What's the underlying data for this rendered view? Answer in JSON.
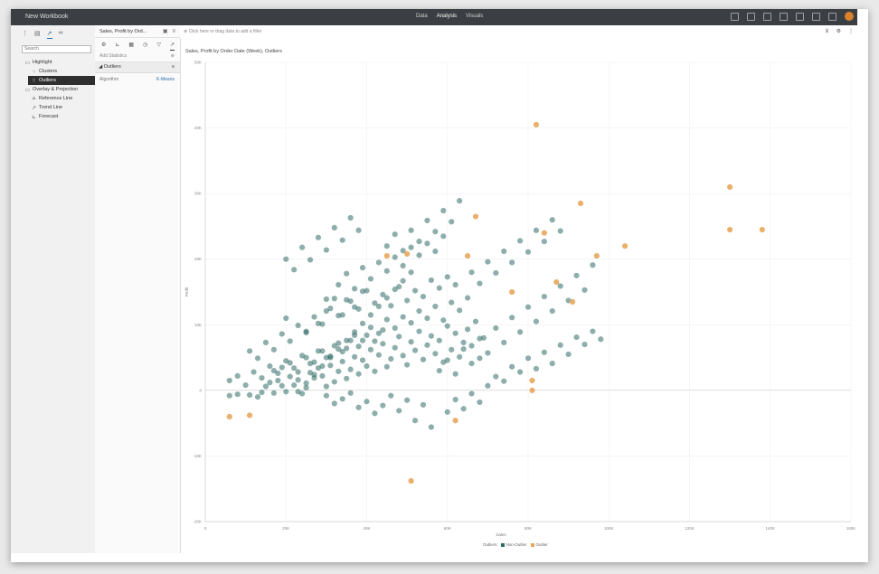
{
  "app": {
    "title": "New Workbook",
    "menu": [
      "Data",
      "Analysis",
      "Visuals"
    ],
    "menu_active": 1
  },
  "left_panel": {
    "tabs": [
      {
        "icon": "layers-icon",
        "glyph": "⋮"
      },
      {
        "icon": "chart-icon",
        "glyph": "▤"
      },
      {
        "icon": "analytics-icon",
        "glyph": "↗"
      },
      {
        "icon": "glasses-icon",
        "glyph": "∞"
      }
    ],
    "search_placeholder": "Search",
    "tree": [
      {
        "label": "Highlight",
        "level": 1,
        "icon": "folder-icon",
        "glyph": "▭"
      },
      {
        "label": "Clusters",
        "level": 2,
        "icon": "clusters-icon",
        "glyph": "⁘"
      },
      {
        "label": "Outliers",
        "level": 2,
        "icon": "outliers-icon",
        "glyph": "⁙",
        "selected": true
      },
      {
        "label": "Overlay & Projection",
        "level": 1,
        "icon": "folder-icon",
        "glyph": "▭"
      },
      {
        "label": "Reference Line",
        "level": 2,
        "icon": "reference-line-icon",
        "glyph": "≟"
      },
      {
        "label": "Trend Line",
        "level": 2,
        "icon": "trend-line-icon",
        "glyph": "↗"
      },
      {
        "label": "Forecast",
        "level": 2,
        "icon": "forecast-icon",
        "glyph": "⊾"
      }
    ]
  },
  "middle_panel": {
    "viz_name": "Sales, Profit by Ord...",
    "icons": [
      "⚙",
      "⊾",
      "▦",
      "◷",
      "▽",
      "↗"
    ],
    "add_statistics": "Add Statistics",
    "section": "Outliers",
    "algorithm_label": "Algorithm",
    "algorithm_value": "K-Means"
  },
  "filter_bar": {
    "placeholder": "Click here or drag data to add a filter"
  },
  "viz": {
    "title": "Sales, Profit by Order Date (Week), Outliers",
    "legend_title": "Outliers",
    "colors": {
      "non_outlier": "#2f6b66",
      "outlier": "#e8a65b",
      "grey": "#b9b9b9"
    }
  },
  "chart_data": {
    "type": "scatter",
    "title": "Sales, Profit by Order Date (Week), Outliers",
    "xlabel": "Sales",
    "ylabel": "Profit",
    "xlim": [
      0,
      160000
    ],
    "ylim": [
      -20000,
      50000
    ],
    "x_ticks": [
      "0",
      "20K",
      "40K",
      "60K",
      "80K",
      "100K",
      "120K",
      "140K",
      "160K"
    ],
    "y_ticks": [
      "-20K",
      "-10K",
      "0",
      "10K",
      "20K",
      "30K",
      "40K",
      "50K"
    ],
    "grid": true,
    "legend_position": "bottom",
    "series": [
      {
        "name": "Non-Outlier",
        "points": [
          [
            6000,
            -800
          ],
          [
            8000,
            -600
          ],
          [
            11000,
            -700
          ],
          [
            13000,
            -1000
          ],
          [
            14000,
            -300
          ],
          [
            15000,
            600
          ],
          [
            16000,
            1200
          ],
          [
            17000,
            -400
          ],
          [
            18000,
            1500
          ],
          [
            19000,
            700
          ],
          [
            20000,
            -200
          ],
          [
            21000,
            2100
          ],
          [
            22000,
            800
          ],
          [
            23000,
            1600
          ],
          [
            24000,
            -500
          ],
          [
            25000,
            400
          ],
          [
            26000,
            2700
          ],
          [
            27000,
            1900
          ],
          [
            28000,
            3400
          ],
          [
            29000,
            2200
          ],
          [
            30000,
            600
          ],
          [
            31000,
            3800
          ],
          [
            32000,
            1300
          ],
          [
            33000,
            2900
          ],
          [
            34000,
            4400
          ],
          [
            35000,
            1800
          ],
          [
            36000,
            3200
          ],
          [
            37000,
            5100
          ],
          [
            38000,
            2500
          ],
          [
            39000,
            4600
          ],
          [
            40000,
            3700
          ],
          [
            41000,
            6200
          ],
          [
            42000,
            2900
          ],
          [
            43000,
            5400
          ],
          [
            44000,
            7100
          ],
          [
            45000,
            3600
          ],
          [
            46000,
            4800
          ],
          [
            47000,
            6500
          ],
          [
            48000,
            8200
          ],
          [
            49000,
            5300
          ],
          [
            50000,
            3900
          ],
          [
            51000,
            7400
          ],
          [
            52000,
            6100
          ],
          [
            53000,
            9000
          ],
          [
            54000,
            4700
          ],
          [
            55000,
            6900
          ],
          [
            56000,
            8300
          ],
          [
            57000,
            5600
          ],
          [
            58000,
            7600
          ],
          [
            59000,
            4300
          ],
          [
            60000,
            9800
          ],
          [
            61000,
            6200
          ],
          [
            62000,
            8700
          ],
          [
            63000,
            5100
          ],
          [
            64000,
            7300
          ],
          [
            65000,
            9300
          ],
          [
            66000,
            6800
          ],
          [
            67000,
            10500
          ],
          [
            68000,
            4900
          ],
          [
            69000,
            8000
          ],
          [
            17000,
            3000
          ],
          [
            19000,
            3500
          ],
          [
            21000,
            4200
          ],
          [
            23000,
            2800
          ],
          [
            25000,
            5000
          ],
          [
            27000,
            4300
          ],
          [
            29000,
            6000
          ],
          [
            31000,
            5200
          ],
          [
            33000,
            7200
          ],
          [
            35000,
            6400
          ],
          [
            37000,
            8400
          ],
          [
            39000,
            7600
          ],
          [
            41000,
            9600
          ],
          [
            43000,
            8700
          ],
          [
            45000,
            10800
          ],
          [
            47000,
            9500
          ],
          [
            49000,
            11200
          ],
          [
            51000,
            10300
          ],
          [
            53000,
            12100
          ],
          [
            55000,
            11000
          ],
          [
            57000,
            12800
          ],
          [
            59000,
            10700
          ],
          [
            61000,
            13400
          ],
          [
            63000,
            12200
          ],
          [
            65000,
            14100
          ],
          [
            20000,
            11000
          ],
          [
            25000,
            9000
          ],
          [
            28000,
            10200
          ],
          [
            30000,
            12100
          ],
          [
            32000,
            14000
          ],
          [
            34000,
            11500
          ],
          [
            36000,
            13600
          ],
          [
            38000,
            12400
          ],
          [
            40000,
            15200
          ],
          [
            42000,
            13300
          ],
          [
            44000,
            14600
          ],
          [
            46000,
            12900
          ],
          [
            48000,
            15800
          ],
          [
            50000,
            13700
          ],
          [
            52000,
            15200
          ],
          [
            54000,
            14300
          ],
          [
            56000,
            16800
          ],
          [
            58000,
            15600
          ],
          [
            60000,
            17300
          ],
          [
            62000,
            16100
          ],
          [
            30000,
            13900
          ],
          [
            33000,
            16100
          ],
          [
            35000,
            17800
          ],
          [
            37000,
            15500
          ],
          [
            39000,
            18700
          ],
          [
            41000,
            17000
          ],
          [
            43000,
            19500
          ],
          [
            45000,
            18200
          ],
          [
            47000,
            20300
          ],
          [
            49000,
            19000
          ],
          [
            51000,
            21800
          ],
          [
            53000,
            20600
          ],
          [
            55000,
            22400
          ],
          [
            57000,
            21200
          ],
          [
            59000,
            23500
          ],
          [
            30000,
            -800
          ],
          [
            32000,
            -2000
          ],
          [
            34000,
            -1300
          ],
          [
            36000,
            -400
          ],
          [
            38000,
            -2600
          ],
          [
            40000,
            -1700
          ],
          [
            42000,
            -3500
          ],
          [
            44000,
            -2300
          ],
          [
            46000,
            -800
          ],
          [
            48000,
            -3100
          ],
          [
            50000,
            -1500
          ],
          [
            52000,
            -4600
          ],
          [
            54000,
            -2200
          ],
          [
            56000,
            -5600
          ],
          [
            60000,
            -3300
          ],
          [
            62000,
            -1400
          ],
          [
            64000,
            -2800
          ],
          [
            66000,
            -500
          ],
          [
            68000,
            -1800
          ],
          [
            70000,
            700
          ],
          [
            72000,
            2100
          ],
          [
            74000,
            1400
          ],
          [
            76000,
            3600
          ],
          [
            78000,
            2800
          ],
          [
            80000,
            4900
          ],
          [
            82000,
            3300
          ],
          [
            84000,
            5800
          ],
          [
            86000,
            4100
          ],
          [
            88000,
            6900
          ],
          [
            90000,
            5500
          ],
          [
            92000,
            8100
          ],
          [
            94000,
            7000
          ],
          [
            96000,
            9000
          ],
          [
            98000,
            7800
          ],
          [
            6000,
            1500
          ],
          [
            8000,
            2200
          ],
          [
            10000,
            800
          ],
          [
            12000,
            2800
          ],
          [
            14000,
            1900
          ],
          [
            16000,
            3700
          ],
          [
            18000,
            2600
          ],
          [
            20000,
            4500
          ],
          [
            22000,
            3400
          ],
          [
            24000,
            5300
          ],
          [
            26000,
            4100
          ],
          [
            28000,
            6000
          ],
          [
            30000,
            5000
          ],
          [
            32000,
            6800
          ],
          [
            34000,
            5900
          ],
          [
            36000,
            7600
          ],
          [
            38000,
            6700
          ],
          [
            40000,
            8400
          ],
          [
            42000,
            7500
          ],
          [
            44000,
            9200
          ],
          [
            23000,
            -200
          ],
          [
            25000,
            1100
          ],
          [
            27000,
            2400
          ],
          [
            29000,
            3700
          ],
          [
            31000,
            5000
          ],
          [
            33000,
            6300
          ],
          [
            35000,
            7600
          ],
          [
            37000,
            8900
          ],
          [
            39000,
            10200
          ],
          [
            41000,
            11500
          ],
          [
            43000,
            12800
          ],
          [
            45000,
            14100
          ],
          [
            47000,
            15400
          ],
          [
            49000,
            16700
          ],
          [
            51000,
            18000
          ],
          [
            11000,
            6000
          ],
          [
            13000,
            4900
          ],
          [
            15000,
            7300
          ],
          [
            17000,
            6200
          ],
          [
            19000,
            8600
          ],
          [
            21000,
            7500
          ],
          [
            23000,
            9900
          ],
          [
            25000,
            8800
          ],
          [
            27000,
            11200
          ],
          [
            29000,
            10100
          ],
          [
            31000,
            12500
          ],
          [
            33000,
            11400
          ],
          [
            35000,
            13800
          ],
          [
            37000,
            12700
          ],
          [
            39000,
            15100
          ],
          [
            58000,
            3000
          ],
          [
            60000,
            4600
          ],
          [
            62000,
            2500
          ],
          [
            64000,
            6300
          ],
          [
            66000,
            4100
          ],
          [
            68000,
            7900
          ],
          [
            70000,
            5700
          ],
          [
            72000,
            9500
          ],
          [
            74000,
            7300
          ],
          [
            76000,
            11100
          ],
          [
            78000,
            8900
          ],
          [
            80000,
            12700
          ],
          [
            82000,
            10500
          ],
          [
            84000,
            14300
          ],
          [
            86000,
            12100
          ],
          [
            88000,
            15900
          ],
          [
            90000,
            13700
          ],
          [
            92000,
            17500
          ],
          [
            94000,
            15300
          ],
          [
            96000,
            19100
          ],
          [
            66000,
            18000
          ],
          [
            68000,
            16300
          ],
          [
            70000,
            19600
          ],
          [
            72000,
            17900
          ],
          [
            74000,
            21200
          ],
          [
            76000,
            19500
          ],
          [
            78000,
            22800
          ],
          [
            80000,
            21100
          ],
          [
            82000,
            24400
          ],
          [
            84000,
            22700
          ],
          [
            86000,
            26000
          ],
          [
            88000,
            24300
          ],
          [
            45000,
            22000
          ],
          [
            47000,
            23800
          ],
          [
            49000,
            21300
          ],
          [
            51000,
            24400
          ],
          [
            53000,
            22700
          ],
          [
            55000,
            25900
          ],
          [
            57000,
            24200
          ],
          [
            59000,
            27400
          ],
          [
            61000,
            25700
          ],
          [
            63000,
            28900
          ],
          [
            20000,
            20000
          ],
          [
            22000,
            18400
          ],
          [
            24000,
            21800
          ],
          [
            26000,
            19900
          ],
          [
            28000,
            23300
          ],
          [
            30000,
            21400
          ],
          [
            32000,
            24800
          ],
          [
            34000,
            22900
          ],
          [
            36000,
            26300
          ],
          [
            38000,
            24400
          ]
        ]
      },
      {
        "name": "Outlier",
        "points": [
          [
            6000,
            -4000
          ],
          [
            11000,
            -3800
          ],
          [
            45000,
            20500
          ],
          [
            50000,
            20800
          ],
          [
            51000,
            -13800
          ],
          [
            62000,
            -4600
          ],
          [
            65000,
            20500
          ],
          [
            67000,
            26500
          ],
          [
            76000,
            15000
          ],
          [
            81000,
            0
          ],
          [
            81000,
            1500
          ],
          [
            82000,
            40500
          ],
          [
            84000,
            24000
          ],
          [
            87000,
            16500
          ],
          [
            91000,
            13500
          ],
          [
            93000,
            28500
          ],
          [
            97000,
            20500
          ],
          [
            104000,
            22000
          ],
          [
            130000,
            31000
          ],
          [
            130000,
            24500
          ],
          [
            138000,
            24500
          ]
        ]
      }
    ]
  }
}
